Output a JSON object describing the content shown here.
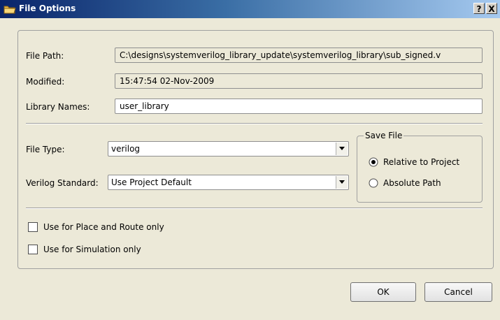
{
  "window": {
    "title": "File Options",
    "help_label": "?",
    "close_label": "X"
  },
  "fields": {
    "file_path_label": "File Path:",
    "file_path_value": "C:\\designs\\systemverilog_library_update\\systemverilog_library\\sub_signed.v",
    "modified_label": "Modified:",
    "modified_value": "15:47:54   02-Nov-2009",
    "library_names_label": "Library Names:",
    "library_names_value": "user_library"
  },
  "options": {
    "file_type_label": "File Type:",
    "file_type_value": "verilog",
    "verilog_standard_label": "Verilog Standard:",
    "verilog_standard_value": "Use Project Default"
  },
  "save_file": {
    "legend": "Save File",
    "relative_label": "Relative to Project",
    "relative_selected": true,
    "absolute_label": "Absolute Path",
    "absolute_selected": false
  },
  "checkboxes": {
    "place_route_label": "Use for Place and Route only",
    "place_route_checked": false,
    "simulation_label": "Use for Simulation only",
    "simulation_checked": false
  },
  "buttons": {
    "ok_label": "OK",
    "cancel_label": "Cancel"
  },
  "icons": {
    "title_icon": "folder-icon",
    "dropdown_icon": "chevron-down-icon"
  },
  "colors": {
    "titlebar_start": "#0a246a",
    "titlebar_end": "#a6caf0",
    "dialog_background": "#ece9d8"
  }
}
